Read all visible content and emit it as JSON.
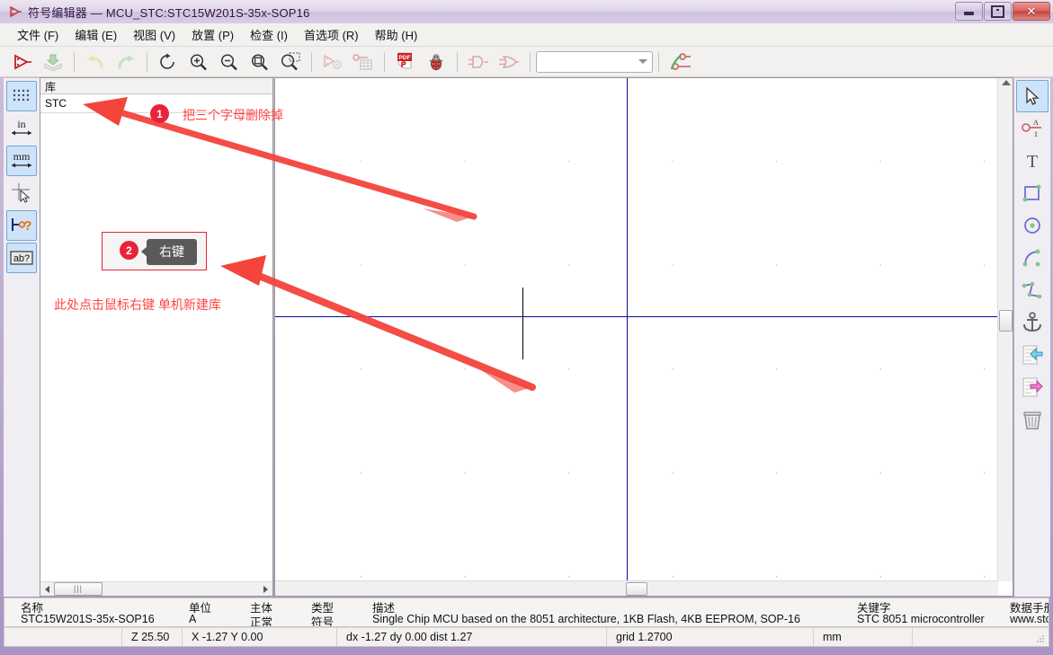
{
  "window": {
    "title": "符号编辑器 — MCU_STC:STC15W201S-35x-SOP16",
    "app_icon": "symbol-editor-icon",
    "controls": {
      "minimize": "minimize-icon",
      "maximize": "maximize-icon",
      "close": "close-icon"
    }
  },
  "menu": [
    {
      "label": "文件 (F)"
    },
    {
      "label": "编辑 (E)"
    },
    {
      "label": "视图 (V)"
    },
    {
      "label": "放置 (P)"
    },
    {
      "label": "检查 (I)"
    },
    {
      "label": "首选项 (R)"
    },
    {
      "label": "帮助 (H)"
    }
  ],
  "toolbar": {
    "items": [
      {
        "name": "new-symbol-icon",
        "enabled": true
      },
      {
        "name": "save-icon",
        "enabled": false
      },
      {
        "name": "undo-icon",
        "enabled": false
      },
      {
        "name": "redo-icon",
        "enabled": false
      },
      {
        "name": "refresh-icon",
        "enabled": true
      },
      {
        "name": "zoom-in-icon",
        "enabled": true
      },
      {
        "name": "zoom-out-icon",
        "enabled": true
      },
      {
        "name": "zoom-fit-icon",
        "enabled": true
      },
      {
        "name": "zoom-area-icon",
        "enabled": true
      },
      {
        "name": "symbol-properties-icon",
        "enabled": false
      },
      {
        "name": "pin-table-icon",
        "enabled": false
      },
      {
        "name": "pdf-export-icon",
        "enabled": true
      },
      {
        "name": "erc-bug-icon",
        "enabled": true
      },
      {
        "name": "deMorgan-standard-icon",
        "enabled": false
      },
      {
        "name": "deMorgan-alternate-icon",
        "enabled": false
      },
      {
        "name": "unit-select-value",
        "enabled": false
      },
      {
        "name": "pin-edit-icon",
        "enabled": true
      }
    ],
    "unit_combo_value": ""
  },
  "left_tools": [
    {
      "name": "toggle-grid-icon",
      "active": true,
      "label": ""
    },
    {
      "name": "units-inches-icon",
      "active": false,
      "label": "in"
    },
    {
      "name": "units-mm-icon",
      "active": true,
      "label": "mm"
    },
    {
      "name": "cursor-fullscreen-icon",
      "active": false,
      "label": ""
    },
    {
      "name": "show-pin-electrical-icon",
      "active": true,
      "label": ""
    },
    {
      "name": "show-hidden-text-icon",
      "active": true,
      "label": "ab?"
    }
  ],
  "right_tools": [
    {
      "name": "select-tool-icon",
      "active": true
    },
    {
      "name": "add-pin-icon",
      "active": false
    },
    {
      "name": "add-text-icon",
      "active": false
    },
    {
      "name": "add-rectangle-icon",
      "active": false
    },
    {
      "name": "add-circle-icon",
      "active": false
    },
    {
      "name": "add-arc-icon",
      "active": false
    },
    {
      "name": "add-polyline-icon",
      "active": false
    },
    {
      "name": "place-anchor-icon",
      "active": false
    },
    {
      "name": "import-symbol-icon",
      "active": false
    },
    {
      "name": "export-symbol-icon",
      "active": false
    },
    {
      "name": "delete-item-icon",
      "active": false
    }
  ],
  "library_panel": {
    "header": "库",
    "filter_value": "STC",
    "filter_placeholder": ""
  },
  "annotations": [
    {
      "id": "ann-1",
      "number": "1",
      "text": "把三个字母删除掉"
    },
    {
      "id": "ann-2",
      "number": "2",
      "tooltip": "右键",
      "text": "此处点击鼠标右键 单机新建库"
    }
  ],
  "info_table": {
    "columns": [
      "名称",
      "单位",
      "主体",
      "类型",
      "描述",
      "关键字",
      "数据手册"
    ],
    "row": {
      "名称": "STC15W201S-35x-SOP16",
      "单位": "A",
      "主体": "正常",
      "类型": "符号",
      "描述": "Single Chip MCU based on the 8051 architecture, 1KB Flash, 4KB EEPROM, SOP-16",
      "关键字": "STC 8051 microcontroller",
      "数据手册": "www.stc"
    }
  },
  "status_bar": {
    "zoom": "Z 25.50",
    "coords": "X -1.27  Y 0.00",
    "delta": "dx -1.27  dy 0.00  dist 1.27",
    "grid": "grid 1.2700",
    "units": "mm",
    "extra": ""
  },
  "colors": {
    "accent_red": "#e8233a",
    "annotation_text": "#ff4444",
    "axis_blue": "#0a0aa0",
    "title_gradient": "#cfc3dd"
  }
}
